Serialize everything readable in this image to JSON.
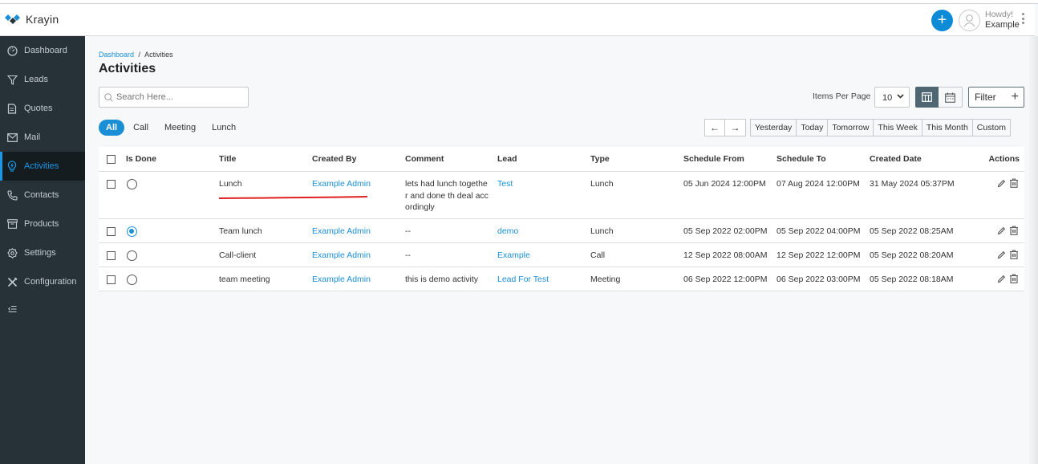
{
  "app": {
    "name": "Krayin"
  },
  "header": {
    "greeting": "Howdy!",
    "user_name": "Example",
    "add_label": "+"
  },
  "sidebar": {
    "items": [
      {
        "label": "Dashboard",
        "icon": "dashboard-icon",
        "active": false
      },
      {
        "label": "Leads",
        "icon": "filter-icon",
        "active": false
      },
      {
        "label": "Quotes",
        "icon": "document-icon",
        "active": false
      },
      {
        "label": "Mail",
        "icon": "mail-icon",
        "active": false
      },
      {
        "label": "Activities",
        "icon": "lightbulb-icon",
        "active": true
      },
      {
        "label": "Contacts",
        "icon": "phone-icon",
        "active": false
      },
      {
        "label": "Products",
        "icon": "box-icon",
        "active": false
      },
      {
        "label": "Settings",
        "icon": "gear-icon",
        "active": false
      },
      {
        "label": "Configuration",
        "icon": "tools-icon",
        "active": false
      }
    ],
    "collapse_icon": "collapse-menu-icon"
  },
  "breadcrumb": {
    "parent": "Dashboard",
    "separator": "/",
    "current": "Activities"
  },
  "page": {
    "title": "Activities"
  },
  "search": {
    "placeholder": "Search Here...",
    "value": ""
  },
  "type_tabs": [
    {
      "label": "All",
      "active": true
    },
    {
      "label": "Call",
      "active": false
    },
    {
      "label": "Meeting",
      "active": false
    },
    {
      "label": "Lunch",
      "active": false
    }
  ],
  "toolbar": {
    "items_per_page_label": "Items Per Page",
    "items_per_page_value": "10",
    "filter_label": "Filter",
    "filter_plus": "+",
    "prev_arrow": "←",
    "next_arrow": "→",
    "date_ranges": [
      "Yesterday",
      "Today",
      "Tomorrow",
      "This Week",
      "This Month",
      "Custom"
    ]
  },
  "table": {
    "columns": [
      "Is Done",
      "Title",
      "Created By",
      "Comment",
      "Lead",
      "Type",
      "Schedule From",
      "Schedule To",
      "Created Date",
      "Actions"
    ],
    "rows": [
      {
        "is_done": false,
        "title": "Lunch",
        "created_by": "Example Admin",
        "comment": "lets had lunch together and done th deal accordingly",
        "lead": "Test",
        "type": "Lunch",
        "schedule_from": "05 Jun 2024 12:00PM",
        "schedule_to": "07 Aug 2024 12:00PM",
        "created_date": "31 May 2024 05:37PM"
      },
      {
        "is_done": true,
        "title": "Team lunch",
        "created_by": "Example Admin",
        "comment": "--",
        "lead": "demo",
        "type": "Lunch",
        "schedule_from": "05 Sep 2022 02:00PM",
        "schedule_to": "05 Sep 2022 04:00PM",
        "created_date": "05 Sep 2022 08:25AM"
      },
      {
        "is_done": false,
        "title": "Call-client",
        "created_by": "Example Admin",
        "comment": "--",
        "lead": "Example",
        "type": "Call",
        "schedule_from": "12 Sep 2022 08:00AM",
        "schedule_to": "12 Sep 2022 12:00PM",
        "created_date": "05 Sep 2022 08:20AM"
      },
      {
        "is_done": false,
        "title": "team meeting",
        "created_by": "Example Admin",
        "comment": "this is demo activity",
        "lead": "Lead For Test",
        "type": "Meeting",
        "schedule_from": "06 Sep 2022 12:00PM",
        "schedule_to": "06 Sep 2022 03:00PM",
        "created_date": "05 Sep 2022 08:18AM"
      }
    ]
  },
  "annotation": {
    "color": "#e02020"
  },
  "colors": {
    "accent": "#1b8fd6",
    "sidebar_bg": "#263238",
    "sidebar_active_bg": "#151c20"
  }
}
